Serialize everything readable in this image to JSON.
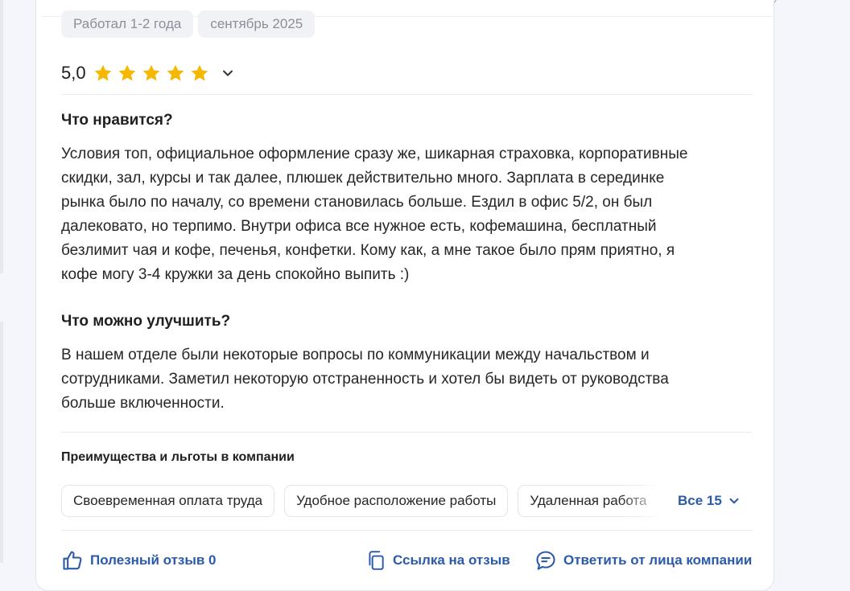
{
  "tags": [
    "Работал 1-2 года",
    "сентябрь 2025"
  ],
  "rating": {
    "value_text": "5,0",
    "stars": 5,
    "star_color": "#f5b800"
  },
  "likes": {
    "heading": "Что нравится?",
    "lines": [
      "Условия топ, официальное оформление сразу же, шикарная страховка, корпоративные",
      "скидки, зал, курсы и так далее, плюшек действительно много. Зарплата в серединке",
      "рынка было по началу, со времени становилась больше. Ездил в офис 5/2, он был",
      "далековато, но терпимо. Внутри офиса все нужное есть, кофемашина, бесплатный",
      "безлимит чая и кофе, печенья, конфетки. Кому как, а мне такое было прям приятно, я",
      "кофе могу 3-4 кружки за день спокойно выпить :)"
    ]
  },
  "improve": {
    "heading": "Что можно улучшить?",
    "lines": [
      "В нашем отделе были некоторые вопросы по коммуникации между начальством и",
      "сотрудниками. Заметил некоторую отстраненность и хотел бы видеть от руководства",
      "больше включенности."
    ]
  },
  "benefits": {
    "title": "Преимущества и льготы в компании",
    "chips": [
      "Своевременная оплата труда",
      "Удобное расположение работы",
      "Удаленная работа"
    ],
    "all_label": "Все 15"
  },
  "actions": {
    "helpful": "Полезный отзыв 0",
    "link": "Ссылка на отзыв",
    "reply": "Ответить от лица компании"
  },
  "colors": {
    "accent": "#2b5aa8",
    "star": "#f5b800",
    "tag_bg": "#f1f2f5",
    "tag_text": "#8a8f99"
  }
}
